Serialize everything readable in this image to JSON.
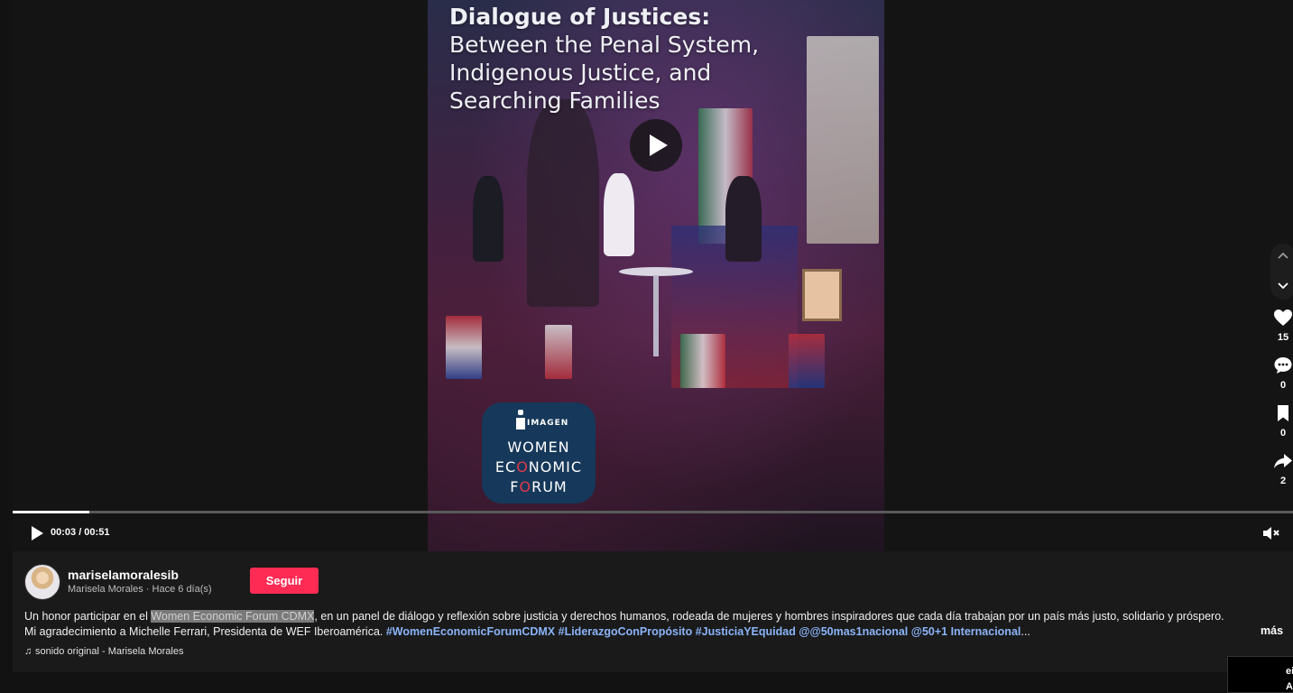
{
  "video": {
    "title_line1": "Dialogue of Justices:",
    "title_line2": "Between the Penal System,",
    "title_line3": "Indigenous Justice, and",
    "title_line4": "Searching Families",
    "badge_imagen": "IMAGEN",
    "badge_line1": "WOMEN",
    "badge_line2_a": "EC",
    "badge_line2_o": "O",
    "badge_line2_b": "NOMIC",
    "badge_line3_a": "F",
    "badge_line3_o": "O",
    "badge_line3_b": "RUM"
  },
  "player": {
    "time": "00:03 / 00:51",
    "progress_fraction": 0.06,
    "play_icon": "play-icon",
    "mute_icon": "mute-icon"
  },
  "actions": {
    "likes": "15",
    "comments": "0",
    "saves": "0",
    "shares": "2"
  },
  "author": {
    "username": "mariselamoralesib",
    "display_name": "Marisela Morales",
    "separator": " · ",
    "posted": "Hace 6 día(s)",
    "follow_label": "Seguir"
  },
  "caption": {
    "before": "Un honor participar en el ",
    "highlight": "Women Economic Forum CDMX",
    "after": ", en un panel de diálogo y reflexión sobre justicia y derechos humanos, rodeada de mujeres y hombres inspiradores que cada día trabajan por un país más justo, solidario y próspero. Mi agradecimiento a Michelle Ferrari, Presidenta de WEF Iberoamérica. ",
    "tags": "#WomenEconomicForumCDMX #LiderazgoConPropósito #JusticiaYEquidad @@50mas1nacional @50+1 Internacional",
    "ellipsis": "...",
    "more_label": "más"
  },
  "sound": {
    "label": "sonido original - Marisela Morales"
  },
  "corner": {
    "line1": "ei",
    "line2": "A"
  },
  "colors": {
    "follow": "#fe2c55",
    "hashtag": "#8ab4f8",
    "background": "#121212"
  }
}
